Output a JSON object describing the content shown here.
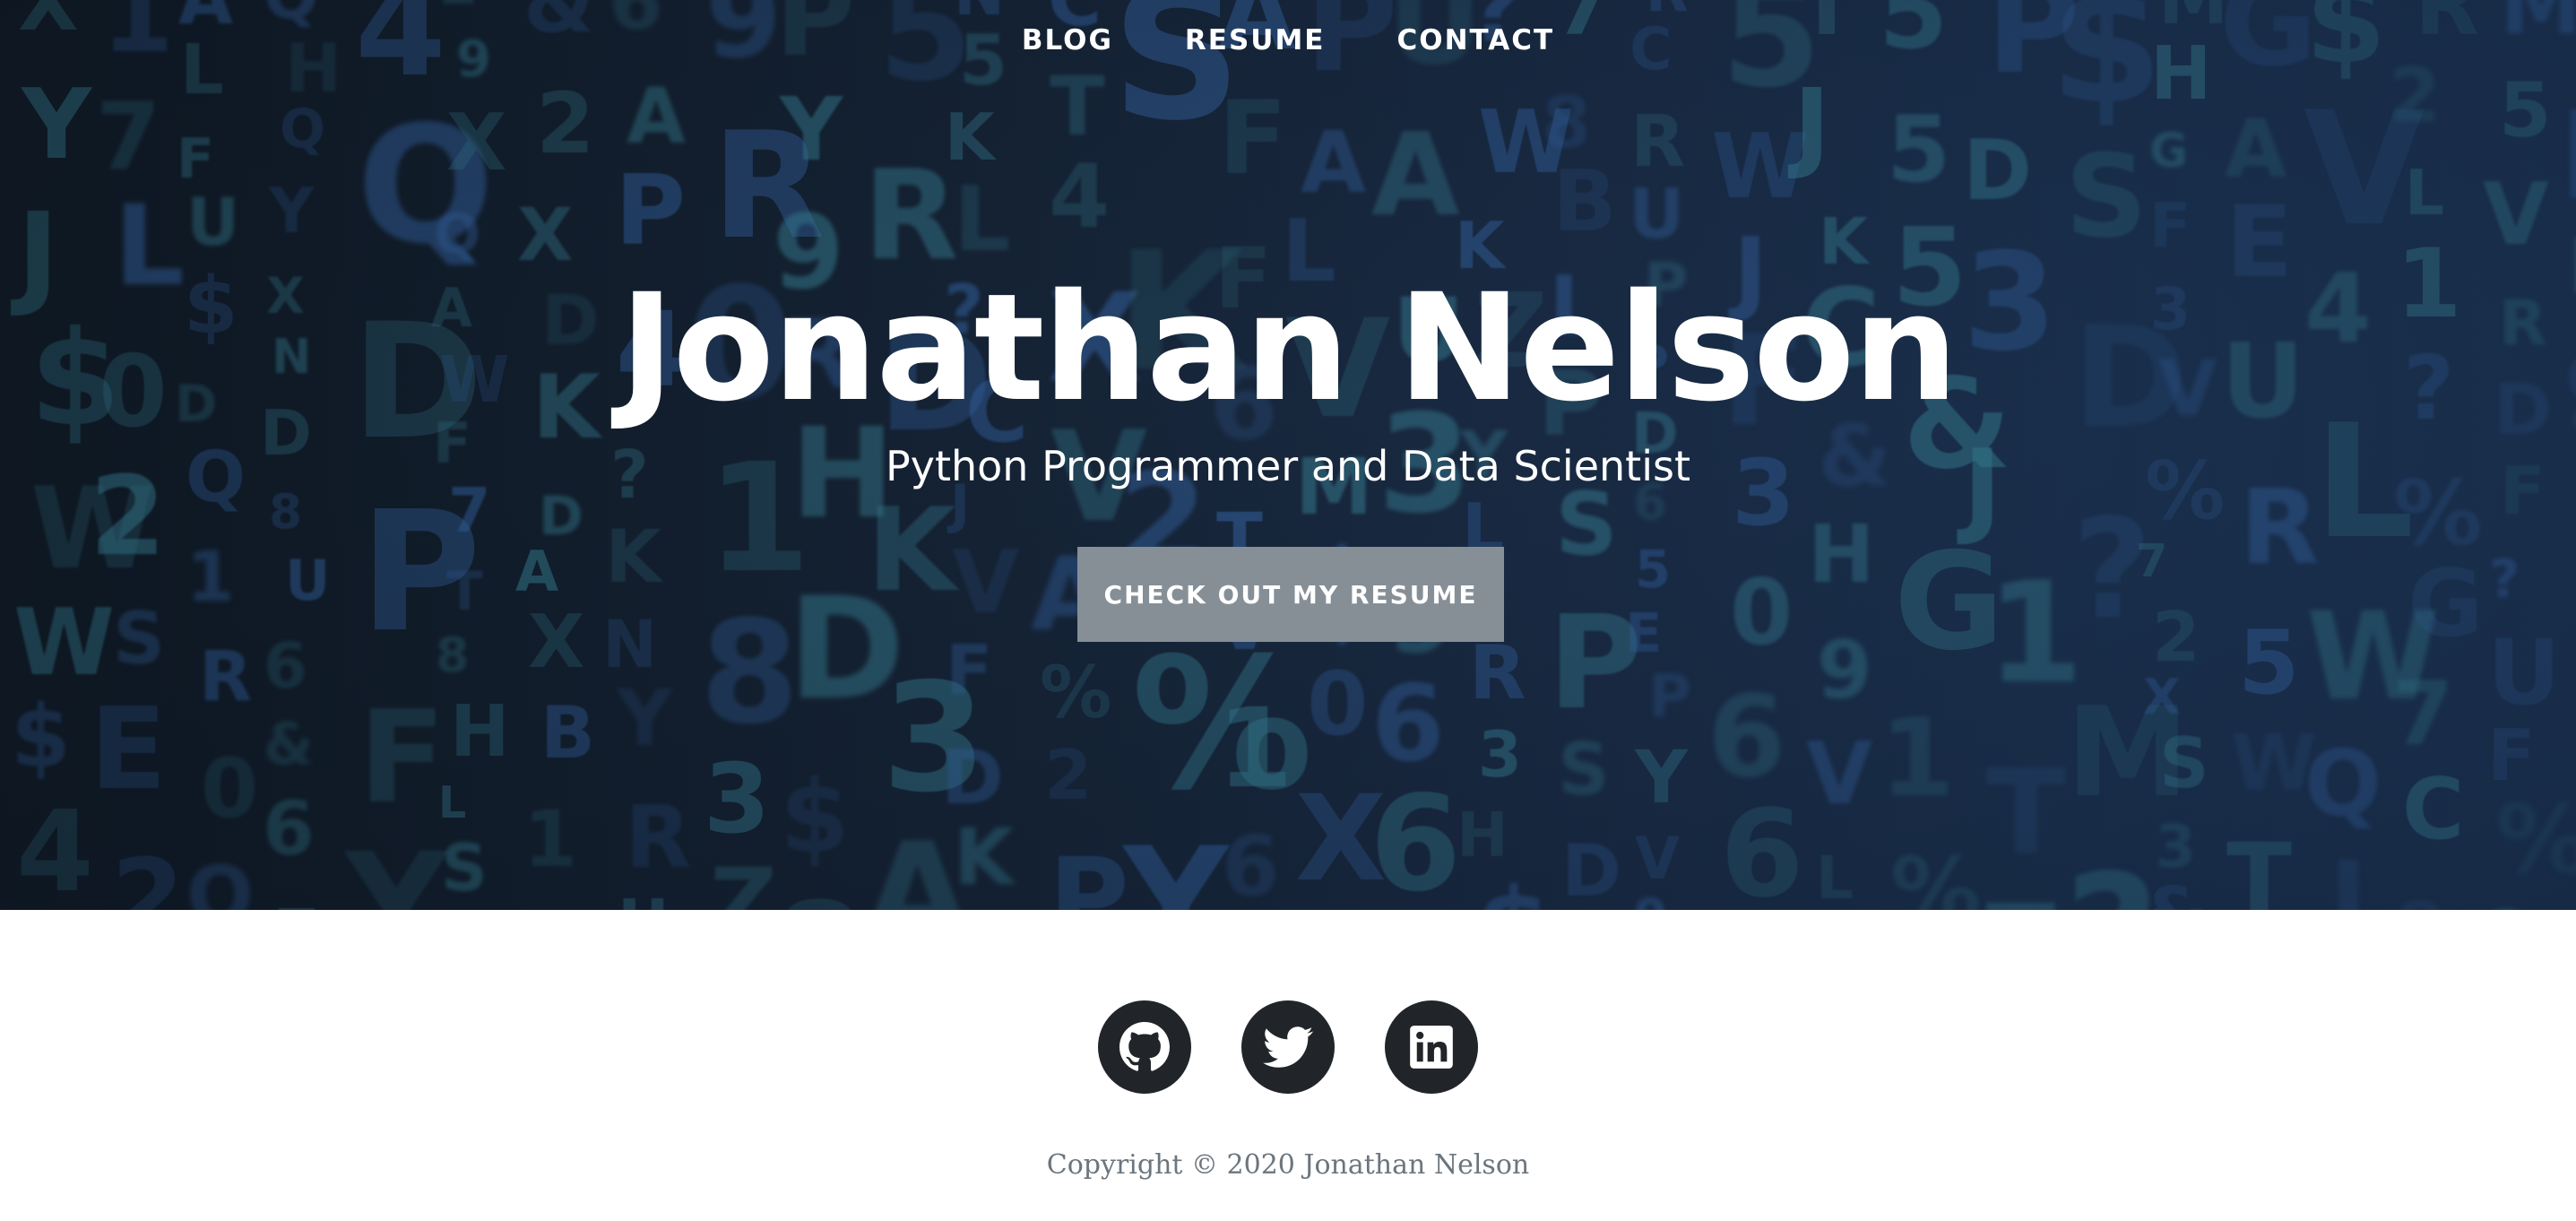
{
  "nav": {
    "items": [
      {
        "label": "BLOG"
      },
      {
        "label": "RESUME"
      },
      {
        "label": "CONTACT"
      }
    ]
  },
  "hero": {
    "title": "Jonathan Nelson",
    "subtitle": "Python Programmer and Data Scientist",
    "cta_label": "CHECK OUT MY RESUME"
  },
  "social": {
    "icons": [
      "github-icon",
      "twitter-icon",
      "linkedin-icon"
    ]
  },
  "footer": {
    "copyright": "Copyright © 2020 Jonathan Nelson"
  },
  "colors": {
    "cta_background": "#868e96",
    "social_background": "#212529",
    "copyright_text": "#6c757d",
    "hero_tint": "#1c3352"
  }
}
